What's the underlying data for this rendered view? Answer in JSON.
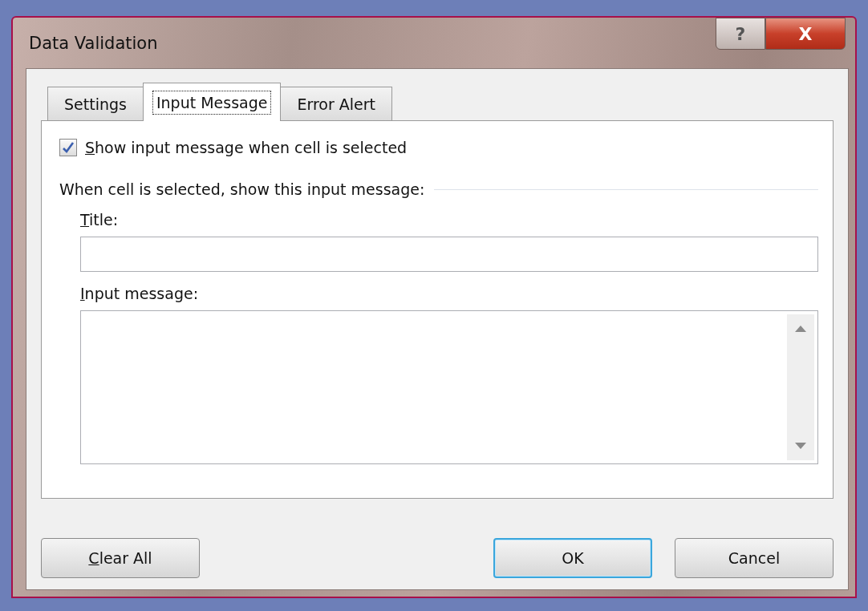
{
  "window": {
    "title": "Data Validation",
    "controls": [
      {
        "kind": "help",
        "label": "?"
      },
      {
        "kind": "close",
        "label": "X"
      }
    ]
  },
  "tabs": [
    {
      "label": "Settings",
      "selected": false
    },
    {
      "label": "Input Message",
      "selected": true
    },
    {
      "label": "Error Alert",
      "selected": false
    }
  ],
  "show_message_checkbox": {
    "access_key": "S",
    "label_after": "how input message when cell is selected",
    "checked": true
  },
  "group_label": "When cell is selected, show this input message:",
  "title_field": {
    "access_key": "T",
    "label_after": "itle:"
  },
  "message_field": {
    "access_key": "I",
    "label_after": "nput message:"
  },
  "buttons": [
    {
      "access_key": "C",
      "label_after": "lear All",
      "default": false
    },
    {
      "label_after": "OK",
      "default": true
    },
    {
      "label_after": "Cancel",
      "default": false
    }
  ]
}
